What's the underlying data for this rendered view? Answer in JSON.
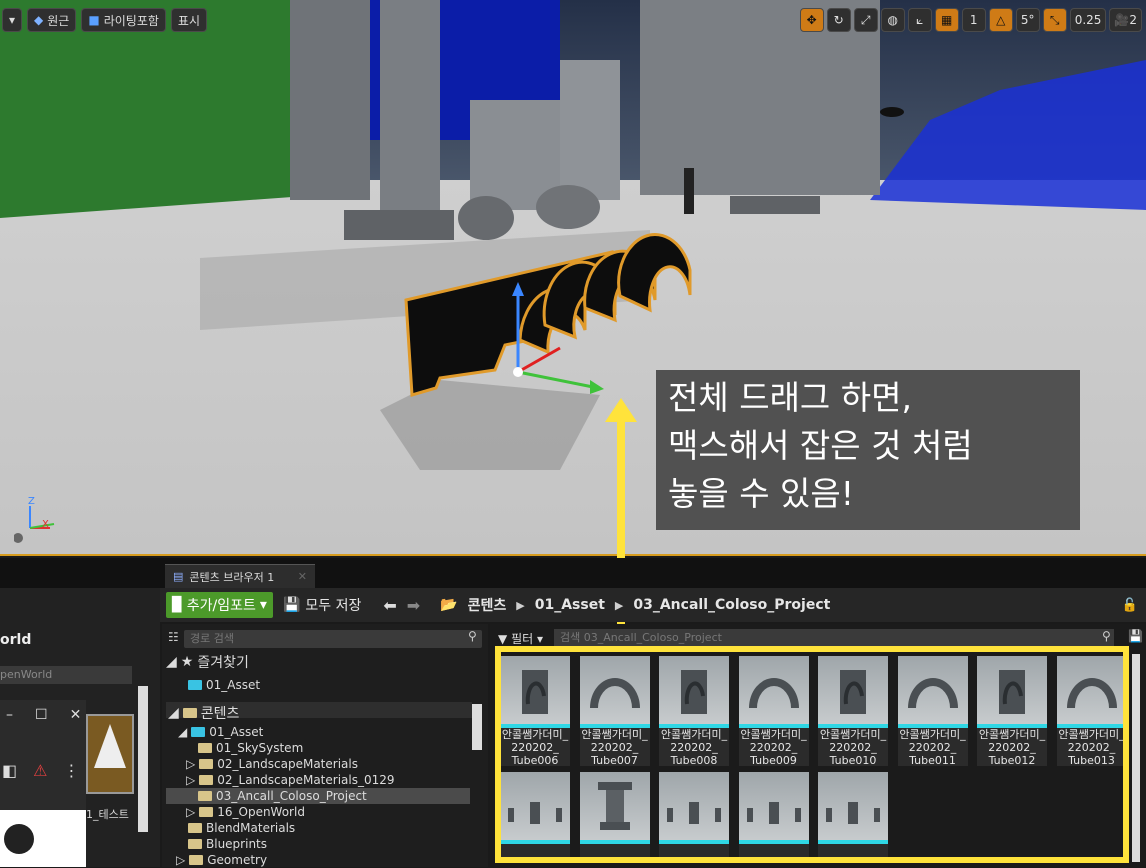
{
  "viewport": {
    "perspective_label": "원근",
    "lighting_label": "라이팅포함",
    "show_label": "표시",
    "grid_snap_value": "5°",
    "rotation_snap_value": "0.25",
    "camera_speed_value": "2",
    "axis_z": "Z",
    "axis_x": "X"
  },
  "annotation": {
    "line1": "전체 드래그 하면,",
    "line2": "맥스해서 잡은 것 처럼",
    "line3": "놓을 수 있음!"
  },
  "content_browser": {
    "tab_label": "콘텐츠 브라우저 1",
    "add_import_label": "추가/임포트",
    "save_all_label": "모두 저장",
    "breadcrumb": [
      "콘텐츠",
      "01_Asset",
      "03_Ancall_Coloso_Project"
    ],
    "path_search_placeholder": "경로 검색",
    "filter_label": "필터",
    "asset_search_placeholder": "검색 03_Ancall_Coloso_Project",
    "favorites_label": "즐겨찾기",
    "favorites": [
      "01_Asset"
    ],
    "content_label": "콘텐츠",
    "tree": [
      {
        "label": "01_Asset",
        "level": 1
      },
      {
        "label": "01_SkySystem",
        "level": 2
      },
      {
        "label": "02_LandscapeMaterials",
        "level": 2
      },
      {
        "label": "02_LandscapeMaterials_0129",
        "level": 2
      },
      {
        "label": "03_Ancall_Coloso_Project",
        "level": 2
      },
      {
        "label": "16_OpenWorld",
        "level": 2
      },
      {
        "label": "BlendMaterials",
        "level": 1
      },
      {
        "label": "Blueprints",
        "level": 1
      },
      {
        "label": "Geometry",
        "level": 1
      }
    ],
    "assets_row1": [
      {
        "line1": "안콜쌤가더미_",
        "line2": "220202_",
        "line3": "Tube006"
      },
      {
        "line1": "안콜쌤가더미_",
        "line2": "220202_",
        "line3": "Tube007"
      },
      {
        "line1": "안콜쌤가더미_",
        "line2": "220202_",
        "line3": "Tube008"
      },
      {
        "line1": "안콜쌤가더미_",
        "line2": "220202_",
        "line3": "Tube009"
      },
      {
        "line1": "안콜쌤가더미_",
        "line2": "220202_",
        "line3": "Tube010"
      },
      {
        "line1": "안콜쌤가더미_",
        "line2": "220202_",
        "line3": "Tube011"
      },
      {
        "line1": "안콜쌤가더미_",
        "line2": "220202_",
        "line3": "Tube012"
      },
      {
        "line1": "안콜쌤가더미_",
        "line2": "220202_",
        "line3": "Tube013"
      }
    ],
    "assets_row2_count_label": ""
  },
  "left_panel": {
    "world_label": "orld",
    "search_value": "penWorld",
    "thumb_label": "1_테스트"
  }
}
